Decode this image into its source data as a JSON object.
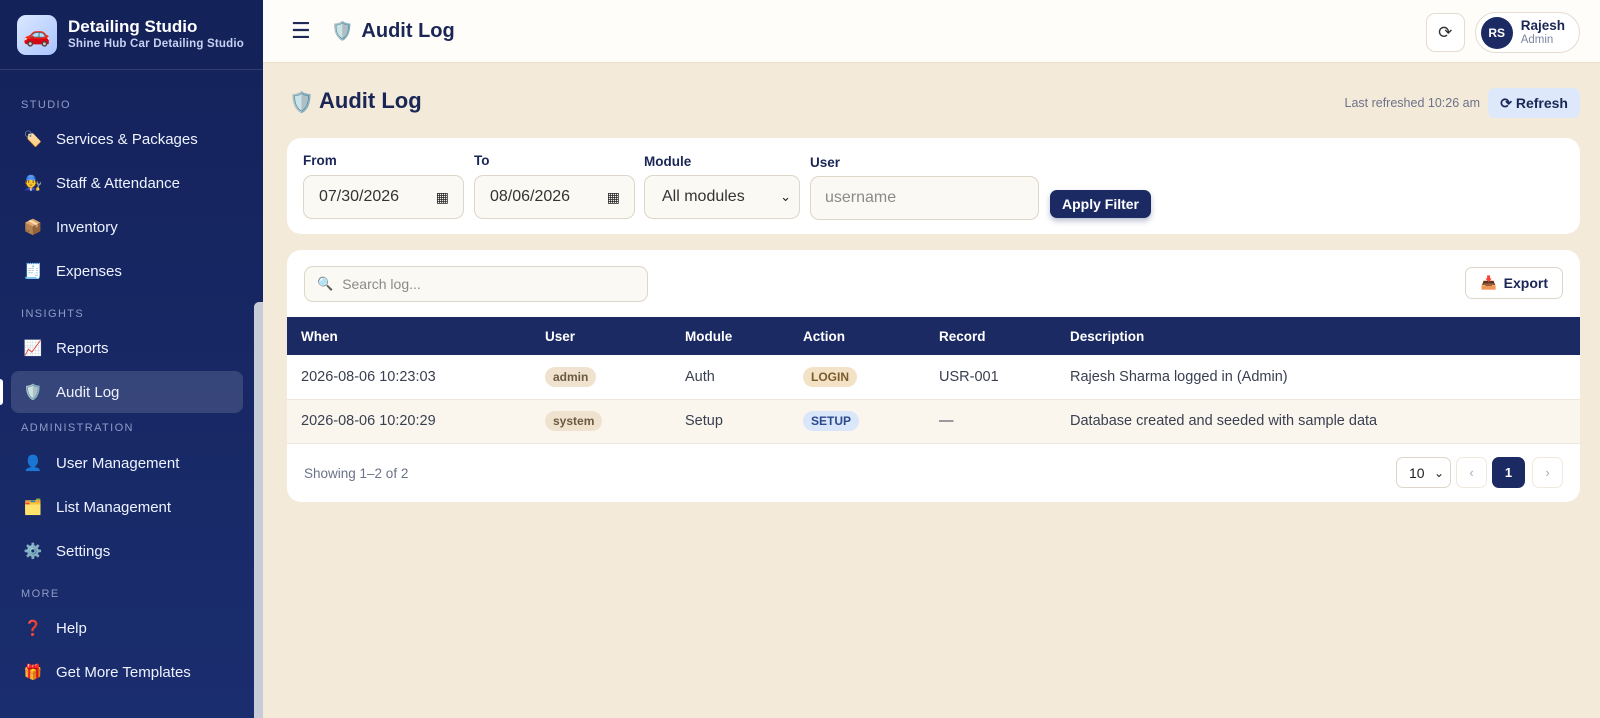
{
  "brand": {
    "title": "Detailing Studio",
    "subtitle": "Shine Hub Car Detailing Studio",
    "logo_icon": "🚗"
  },
  "sidebar": {
    "sections": [
      {
        "label": "STUDIO",
        "items": [
          {
            "label": "Services & Packages",
            "icon": "🏷️"
          },
          {
            "label": "Staff & Attendance",
            "icon": "🧑‍🔧"
          },
          {
            "label": "Inventory",
            "icon": "📦"
          },
          {
            "label": "Expenses",
            "icon": "🧾"
          }
        ]
      },
      {
        "label": "INSIGHTS",
        "items": [
          {
            "label": "Reports",
            "icon": "📈"
          },
          {
            "label": "Audit Log",
            "icon": "🛡️",
            "active": true
          }
        ]
      },
      {
        "label": "ADMINISTRATION",
        "items": [
          {
            "label": "User Management",
            "icon": "👤"
          },
          {
            "label": "List Management",
            "icon": "🗂️"
          },
          {
            "label": "Settings",
            "icon": "⚙️"
          }
        ]
      },
      {
        "label": "MORE",
        "items": [
          {
            "label": "Help",
            "icon": "❓"
          },
          {
            "label": "Get More Templates",
            "icon": "🎁"
          }
        ]
      }
    ]
  },
  "topbar": {
    "title": "Audit Log",
    "title_icon": "🛡️",
    "menu_icon": "☰",
    "refresh_icon": "⟳"
  },
  "user": {
    "initials": "RS",
    "name": "Rajesh",
    "role": "Admin"
  },
  "page": {
    "title": "Audit Log",
    "last_refreshed": "Last refreshed 10:26 am",
    "refresh_label": "⟳ Refresh"
  },
  "filters": {
    "from_label": "From",
    "from_value": "07/30/2026",
    "to_label": "To",
    "to_value": "08/06/2026",
    "module_label": "Module",
    "module_value": "All modules",
    "user_label": "User",
    "user_placeholder": "username",
    "apply_label": "Apply Filter"
  },
  "table": {
    "search_placeholder": "Search log...",
    "export_label": "Export",
    "columns": [
      "When",
      "User",
      "Module",
      "Action",
      "Record",
      "Description"
    ],
    "rows": [
      {
        "when": "2026-08-06 10:23:03",
        "user": "admin",
        "module": "Auth",
        "action": "LOGIN",
        "record": "USR-001",
        "description": "Rajesh Sharma logged in (Admin)"
      },
      {
        "when": "2026-08-06 10:20:29",
        "user": "system",
        "module": "Setup",
        "action": "SETUP",
        "record": "—",
        "description": "Database created and seeded with sample data"
      }
    ],
    "showing": "Showing 1–2 of 2",
    "page_size": "10",
    "current_page": "1",
    "prev": "‹",
    "next": "›"
  }
}
